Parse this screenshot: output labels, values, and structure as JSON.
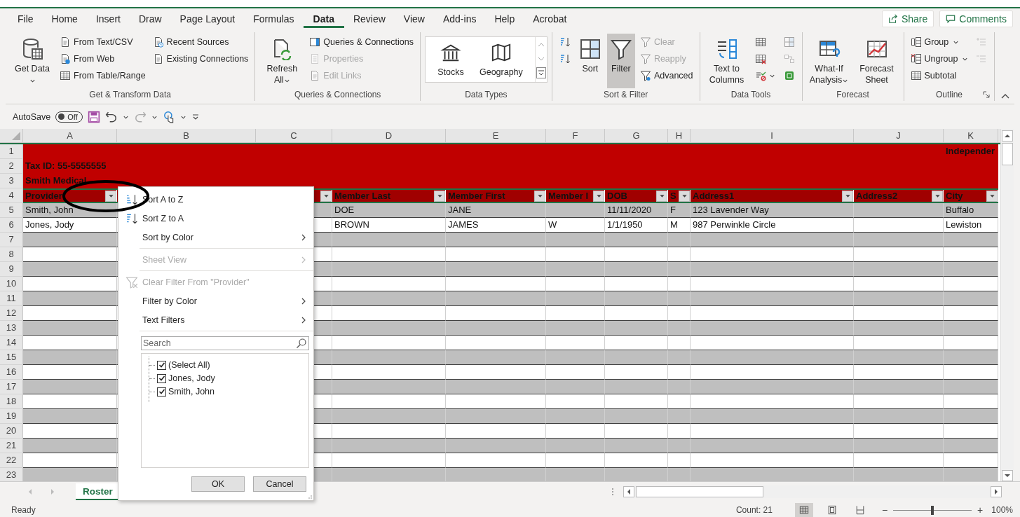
{
  "window": {
    "tabs": [
      {
        "label": "File",
        "selected": false
      },
      {
        "label": "Home",
        "selected": false
      },
      {
        "label": "Insert",
        "selected": false
      },
      {
        "label": "Draw",
        "selected": false
      },
      {
        "label": "Page Layout",
        "selected": false
      },
      {
        "label": "Formulas",
        "selected": false
      },
      {
        "label": "Data",
        "selected": true
      },
      {
        "label": "Review",
        "selected": false
      },
      {
        "label": "View",
        "selected": false
      },
      {
        "label": "Add-ins",
        "selected": false
      },
      {
        "label": "Help",
        "selected": false
      },
      {
        "label": "Acrobat",
        "selected": false
      }
    ],
    "share_button": "Share",
    "comments_button": "Comments"
  },
  "ribbon": {
    "groups": [
      {
        "label": "Get & Transform Data",
        "kind": "columns",
        "launcher": false,
        "columns": [
          [
            {
              "kind": "large",
              "label": "Get Data",
              "dropdown": true,
              "disabled": false,
              "on": false
            }
          ],
          [
            {
              "kind": "small",
              "label": "From Text/CSV",
              "disabled": false,
              "on": false
            },
            {
              "kind": "small",
              "label": "From Web",
              "disabled": false,
              "on": false
            },
            {
              "kind": "small",
              "label": "From Table/Range",
              "disabled": false,
              "on": false
            }
          ],
          [
            {
              "kind": "small",
              "label": "Recent Sources",
              "disabled": false,
              "on": false
            },
            {
              "kind": "small",
              "label": "Existing Connections",
              "disabled": false,
              "on": false
            }
          ]
        ]
      },
      {
        "label": "Queries & Connections",
        "kind": "columns",
        "launcher": false,
        "columns": [
          [
            {
              "kind": "large",
              "label": "Refresh All",
              "dropdown": true,
              "disabled": false,
              "on": false
            }
          ],
          [
            {
              "kind": "small",
              "label": "Queries & Connections",
              "disabled": false,
              "on": false
            },
            {
              "kind": "small",
              "label": "Properties",
              "disabled": true,
              "on": false
            },
            {
              "kind": "small",
              "label": "Edit Links",
              "disabled": true,
              "on": false
            }
          ]
        ]
      },
      {
        "label": "Data Types",
        "kind": "gallery",
        "launcher": false,
        "items": [
          {
            "label": "Stocks"
          },
          {
            "label": "Geography"
          }
        ]
      },
      {
        "label": "Sort & Filter",
        "kind": "columns",
        "launcher": false,
        "columns": [
          [
            {
              "kind": "icon",
              "disabled": false,
              "on": false
            },
            {
              "kind": "icon",
              "disabled": false,
              "on": false
            }
          ],
          [
            {
              "kind": "large",
              "label": "Sort",
              "disabled": false,
              "on": false
            }
          ],
          [
            {
              "kind": "large",
              "label": "Filter",
              "disabled": false,
              "on": true
            }
          ],
          [
            {
              "kind": "small",
              "label": "Clear",
              "disabled": true,
              "on": false
            },
            {
              "kind": "small",
              "label": "Reapply",
              "disabled": true,
              "on": false
            },
            {
              "kind": "small",
              "label": "Advanced",
              "disabled": false,
              "on": false
            }
          ]
        ]
      },
      {
        "label": "Data Tools",
        "kind": "columns",
        "launcher": false,
        "columns": [
          [
            {
              "kind": "large",
              "label": "Text to Columns",
              "disabled": false,
              "on": false
            }
          ],
          [
            {
              "kind": "icon",
              "disabled": false,
              "on": false
            },
            {
              "kind": "icon",
              "disabled": false,
              "on": false
            },
            {
              "kind": "icon",
              "dropdown": true,
              "disabled": false,
              "on": false
            }
          ],
          [
            {
              "kind": "icon",
              "disabled": true,
              "on": false
            },
            {
              "kind": "icon",
              "disabled": true,
              "on": false
            },
            {
              "kind": "icon",
              "disabled": false,
              "on": false
            }
          ]
        ]
      },
      {
        "label": "Forecast",
        "kind": "columns",
        "launcher": false,
        "columns": [
          [
            {
              "kind": "large",
              "label": "What-If Analysis",
              "dropdown": true,
              "disabled": false,
              "on": false
            }
          ],
          [
            {
              "kind": "large",
              "label": "Forecast Sheet",
              "disabled": false,
              "on": false
            }
          ]
        ]
      },
      {
        "label": "Outline",
        "kind": "columns",
        "launcher": true,
        "columns": [
          [
            {
              "kind": "small",
              "label": "Group",
              "dropdown": true,
              "disabled": false,
              "on": false
            },
            {
              "kind": "small",
              "label": "Ungroup",
              "dropdown": true,
              "disabled": false,
              "on": false
            },
            {
              "kind": "small",
              "label": "Subtotal",
              "disabled": false,
              "on": false
            }
          ],
          [
            {
              "kind": "icon",
              "disabled": true,
              "on": false
            },
            {
              "kind": "icon",
              "disabled": true,
              "on": false
            }
          ]
        ]
      }
    ]
  },
  "quick_access": {
    "autosave_label": "AutoSave",
    "autosave": {
      "on": false,
      "label": "Off"
    }
  },
  "sheet": {
    "columns": [
      "A",
      "B",
      "C",
      "D",
      "E",
      "F",
      "G",
      "H",
      "I",
      "J",
      "K"
    ],
    "rows": [
      {
        "kind": "band",
        "number": "1",
        "cells": [
          null,
          null,
          null,
          null,
          null,
          null,
          null,
          null,
          null,
          null,
          "Independer"
        ]
      },
      {
        "kind": "band",
        "number": "2",
        "cells": [
          "Tax ID: 55-5555555",
          null,
          null,
          null,
          null,
          null,
          null,
          null,
          null,
          null,
          null
        ]
      },
      {
        "kind": "band",
        "number": "3",
        "cells": [
          "Smith Medical",
          null,
          null,
          null,
          null,
          null,
          null,
          null,
          null,
          null,
          null
        ]
      },
      {
        "kind": "header",
        "number": "4",
        "cells": [
          "Provider",
          null,
          null,
          "Member Last",
          "Member First",
          "Member I",
          "DOB",
          "S",
          "Address1",
          "Address2",
          "City"
        ]
      },
      {
        "kind": "data",
        "number": "5",
        "cells": [
          "Smith, John",
          null,
          null,
          "DOE",
          "JANE",
          null,
          "11/11/2020",
          "F",
          "123 Lavender Way",
          null,
          "Buffalo"
        ]
      },
      {
        "kind": "data",
        "number": "6",
        "cells": [
          "Jones, Jody",
          null,
          null,
          "BROWN",
          "JAMES",
          "W",
          "1/1/1950",
          "M",
          "987 Perwinkle Circle",
          null,
          "Lewiston"
        ]
      },
      {
        "kind": "data",
        "number": "7"
      },
      {
        "kind": "data",
        "number": "8"
      },
      {
        "kind": "data",
        "number": "9"
      },
      {
        "kind": "data",
        "number": "10"
      },
      {
        "kind": "data",
        "number": "11"
      },
      {
        "kind": "data",
        "number": "12"
      },
      {
        "kind": "data",
        "number": "13"
      },
      {
        "kind": "data",
        "number": "14"
      },
      {
        "kind": "data",
        "number": "15"
      },
      {
        "kind": "data",
        "number": "16"
      },
      {
        "kind": "data",
        "number": "17"
      },
      {
        "kind": "data",
        "number": "18"
      },
      {
        "kind": "data",
        "number": "19"
      },
      {
        "kind": "data",
        "number": "20"
      },
      {
        "kind": "data",
        "number": "21"
      },
      {
        "kind": "data",
        "number": "22"
      },
      {
        "kind": "data",
        "number": "23"
      }
    ]
  },
  "filter_menu": {
    "items": [
      {
        "kind": "ascending",
        "label": "Sort A to Z",
        "disabled": false
      },
      {
        "kind": "descending",
        "label": "Sort Z to A",
        "disabled": false
      },
      {
        "kind": "submenu",
        "label": "Sort by Color",
        "disabled": false
      },
      {
        "kind": "separator"
      },
      {
        "kind": "submenu",
        "label": "Sheet View",
        "disabled": true
      },
      {
        "kind": "separator"
      },
      {
        "kind": "clear",
        "label": "Clear Filter From \"Provider\"",
        "disabled": true
      },
      {
        "kind": "submenu",
        "label": "Filter by Color",
        "disabled": false
      },
      {
        "kind": "submenu",
        "label": "Text Filters",
        "disabled": false
      },
      {
        "kind": "separator"
      }
    ],
    "search": {
      "placeholder": "Search"
    },
    "values": [
      {
        "label": "(Select All)",
        "checked": true
      },
      {
        "label": "Jones, Jody",
        "checked": true
      },
      {
        "label": "Smith, John",
        "checked": true
      }
    ],
    "buttons": [
      "OK",
      "Cancel"
    ]
  },
  "sheet_tabs": [
    {
      "label": "Roster",
      "selected": true
    }
  ],
  "status_bar": {
    "status": "Ready",
    "count": "Count: 21",
    "views": [
      {
        "selected": true
      },
      {
        "selected": false
      },
      {
        "selected": false
      }
    ],
    "zoom_out": "−",
    "zoom_in": "+",
    "zoom": {
      "level": 0.5
    },
    "zoom_label": "100%"
  }
}
